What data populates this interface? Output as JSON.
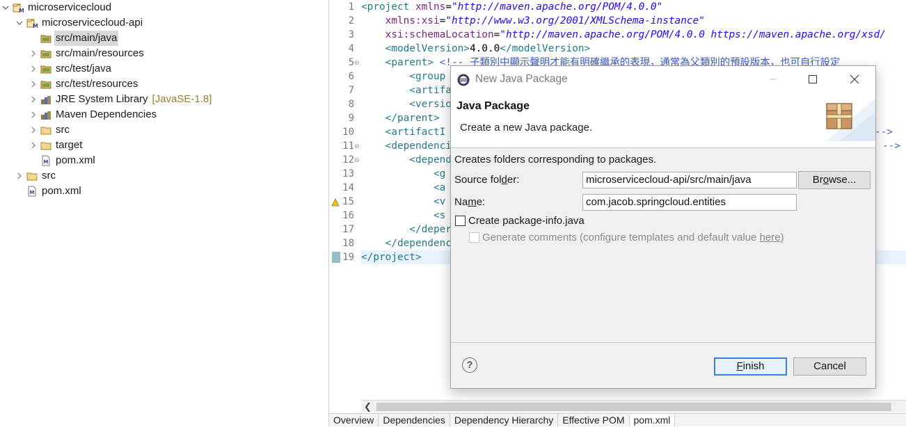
{
  "explorer": {
    "items": [
      {
        "label": "microservicecloud",
        "icon": "maven-project-icon",
        "expanded": true,
        "level": 0
      },
      {
        "label": "microservicecloud-api",
        "icon": "maven-project-icon",
        "expanded": true,
        "level": 1
      },
      {
        "label": "src/main/java",
        "icon": "source-folder-icon",
        "expanded": false,
        "level": 2,
        "selected": true,
        "leaf": true
      },
      {
        "label": "src/main/resources",
        "icon": "source-folder-icon",
        "expanded": false,
        "level": 2
      },
      {
        "label": "src/test/java",
        "icon": "source-folder-icon",
        "expanded": false,
        "level": 2
      },
      {
        "label": "src/test/resources",
        "icon": "source-folder-icon",
        "expanded": false,
        "level": 2
      },
      {
        "label": "JRE System Library",
        "decoration": "[JavaSE-1.8]",
        "icon": "library-icon",
        "expanded": false,
        "level": 2
      },
      {
        "label": "Maven Dependencies",
        "icon": "library-icon",
        "expanded": false,
        "level": 2
      },
      {
        "label": "src",
        "icon": "folder-icon",
        "expanded": false,
        "level": 2
      },
      {
        "label": "target",
        "icon": "folder-icon",
        "expanded": false,
        "level": 2
      },
      {
        "label": "pom.xml",
        "icon": "xml-file-icon",
        "level": 2,
        "leaf": true
      },
      {
        "label": "src",
        "icon": "folder-icon",
        "expanded": false,
        "level": 1
      },
      {
        "label": "pom.xml",
        "icon": "xml-file-icon",
        "level": 1,
        "leaf": true
      }
    ]
  },
  "editor": {
    "line_numbers": [
      "1",
      "2",
      "3",
      "4",
      "5",
      "6",
      "7",
      "8",
      "9",
      "10",
      "11",
      "12",
      "13",
      "14",
      "15",
      "16",
      "17",
      "18",
      "19"
    ],
    "lines": [
      [
        {
          "t": "<project ",
          "c": "tag"
        },
        {
          "t": "xmlns",
          "c": "attr"
        },
        {
          "t": "=",
          "c": "txt"
        },
        {
          "t": "\"http://maven.apache.org/POM/4.0.0\"",
          "c": "val"
        }
      ],
      [
        {
          "t": "    xmlns:xsi",
          "c": "attr"
        },
        {
          "t": "=",
          "c": "txt"
        },
        {
          "t": "\"http://www.w3.org/2001/XMLSchema-instance\"",
          "c": "val"
        }
      ],
      [
        {
          "t": "    xsi:schemaLocation",
          "c": "attr"
        },
        {
          "t": "=",
          "c": "txt"
        },
        {
          "t": "\"http://maven.apache.org/POM/4.0.0 https://maven.apache.org/xsd/",
          "c": "val"
        }
      ],
      [
        {
          "t": "    <modelVersion>",
          "c": "tag"
        },
        {
          "t": "4.0.0",
          "c": "txt"
        },
        {
          "t": "</modelVersion>",
          "c": "tag"
        }
      ],
      [
        {
          "t": "    <parent> ",
          "c": "tag"
        },
        {
          "t": "<!-- 子類別中顯示聲明才能有明確繼承的表現，通常為父類別的預設版本，也可自行設定",
          "c": "cmt"
        }
      ],
      [
        {
          "t": "        <group",
          "c": "tag"
        }
      ],
      [
        {
          "t": "        <artifa",
          "c": "tag"
        }
      ],
      [
        {
          "t": "        <versio",
          "c": "tag"
        }
      ],
      [
        {
          "t": "    </parent>",
          "c": "tag"
        }
      ],
      [
        {
          "t": "    <artifactI",
          "c": "tag"
        }
      ],
      [
        {
          "t": "    <dependenci",
          "c": "tag"
        }
      ],
      [
        {
          "t": "        <depend",
          "c": "tag"
        }
      ],
      [
        {
          "t": "            <g",
          "c": "tag"
        }
      ],
      [
        {
          "t": "            <a",
          "c": "tag"
        }
      ],
      [
        {
          "t": "            <v",
          "c": "tag"
        }
      ],
      [
        {
          "t": "            <s",
          "c": "tag"
        }
      ],
      [
        {
          "t": "        </deper",
          "c": "tag"
        }
      ],
      [
        {
          "t": "    </dependenc",
          "c": "tag"
        }
      ],
      [
        {
          "t": "</project>",
          "c": "tag"
        }
      ]
    ],
    "fragments_right": [
      "-->",
      "-->"
    ],
    "bottom_tabs": [
      "Overview",
      "Dependencies",
      "Dependency Hierarchy",
      "Effective POM",
      "pom.xml"
    ],
    "active_tab": "pom.xml"
  },
  "dialog": {
    "title": "New Java Package",
    "banner_heading": "Java Package",
    "banner_description": "Create a new Java package.",
    "info": "Creates folders corresponding to packages.",
    "source_folder_label": "Source folder:",
    "source_folder_value": "microservicecloud-api/src/main/java",
    "browse_label": "Browse...",
    "name_label": "Name:",
    "name_value": "com.jacob.springcloud.entities",
    "create_info_label": "Create package-info.java",
    "generate_comments_label": "Generate comments (configure templates and default value ",
    "generate_comments_link": "here",
    "generate_comments_suffix": ")",
    "finish_label": "Finish",
    "cancel_label": "Cancel",
    "help_label": "?"
  },
  "colors": {
    "accent": "#3c7fd0",
    "xml_tag": "#1f7a88",
    "xml_attr": "#7f1f7f",
    "xml_value": "#2a00ff",
    "xml_comment": "#3f5fbf"
  }
}
